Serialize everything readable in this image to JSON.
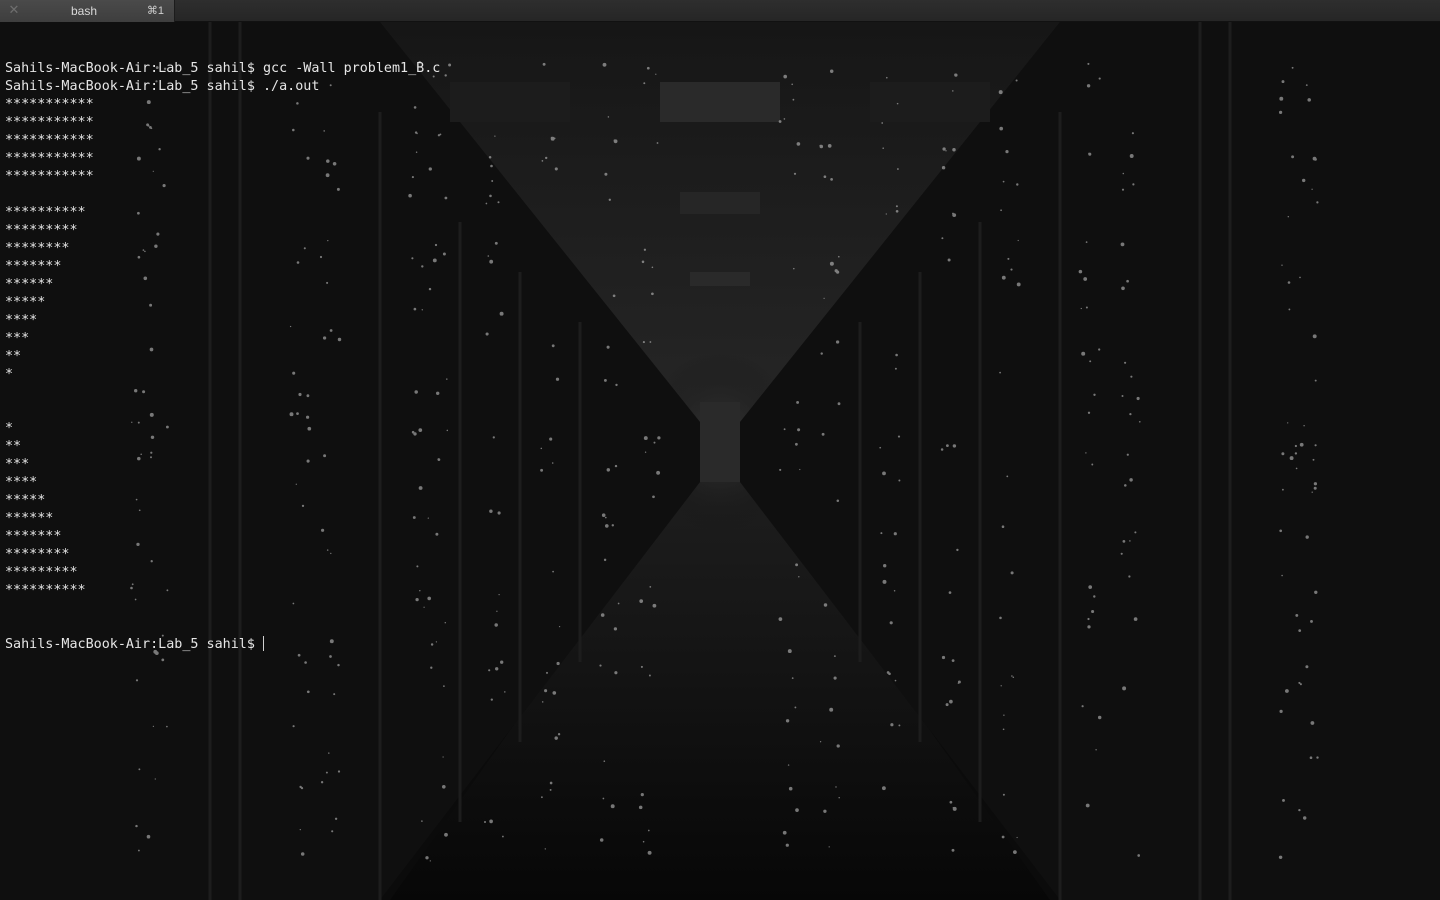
{
  "tab": {
    "close_glyph": "✕",
    "title": "bash",
    "shortcut": "⌘1"
  },
  "terminal": {
    "lines": [
      "Sahils-MacBook-Air:Lab_5 sahil$ gcc -Wall problem1_B.c",
      "Sahils-MacBook-Air:Lab_5 sahil$ ./a.out",
      "***********",
      "***********",
      "***********",
      "***********",
      "***********",
      "",
      "**********",
      "*********",
      "********",
      "*******",
      "******",
      "*****",
      "****",
      "***",
      "**",
      "*",
      "",
      "",
      "*",
      "**",
      "***",
      "****",
      "*****",
      "******",
      "*******",
      "********",
      "*********",
      "**********"
    ],
    "prompt": "Sahils-MacBook-Air:Lab_5 sahil$"
  }
}
